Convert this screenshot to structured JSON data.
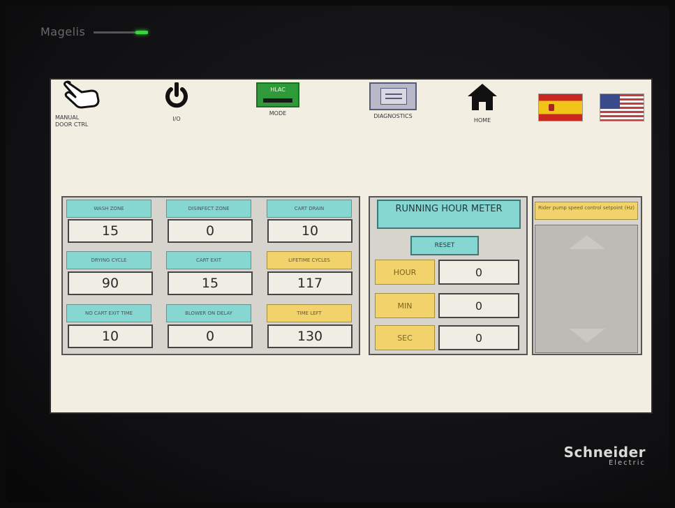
{
  "bezel": {
    "top_brand": "Magelis",
    "bottom_brand": "Schneider",
    "bottom_brand_sub": "Electric"
  },
  "nav": {
    "manual_door": "MANUAL DOOR CTRL",
    "io": "I/O",
    "mode_button_text": "HLAC",
    "mode": "MODE",
    "diagnostics": "DIAGNOSTICS",
    "home": "HOME"
  },
  "params": {
    "wash_zone": {
      "label": "WASH ZONE",
      "value": "15"
    },
    "disinfect_zone": {
      "label": "DISINFECT ZONE",
      "value": "0"
    },
    "cart_drain": {
      "label": "CART DRAIN",
      "value": "10"
    },
    "drying_cycle": {
      "label": "DRYING CYCLE",
      "value": "90"
    },
    "cart_exit": {
      "label": "CART EXIT",
      "value": "15"
    },
    "lifetime_cycles": {
      "label": "LIFETIME CYCLES",
      "value": "117"
    },
    "no_cart_exit_time": {
      "label": "NO CART EXIT TIME",
      "value": "10"
    },
    "blower_on_delay": {
      "label": "BLOWER ON DELAY",
      "value": "0"
    },
    "time_left": {
      "label": "TIME LEFT",
      "value": "130"
    }
  },
  "hour_meter": {
    "title": "RUNNING HOUR METER",
    "reset": "RESET",
    "hour_label": "HOUR",
    "hour_value": "0",
    "min_label": "MIN",
    "min_value": "0",
    "sec_label": "SEC",
    "sec_value": "0"
  },
  "setpoint": {
    "label": "Rider pump speed control setpoint (Hz)"
  },
  "colors": {
    "screen_bg": "#f2efe2",
    "teal": "#86d6d2",
    "yellow": "#f2d36b",
    "mode_green": "#2f9a3a"
  }
}
